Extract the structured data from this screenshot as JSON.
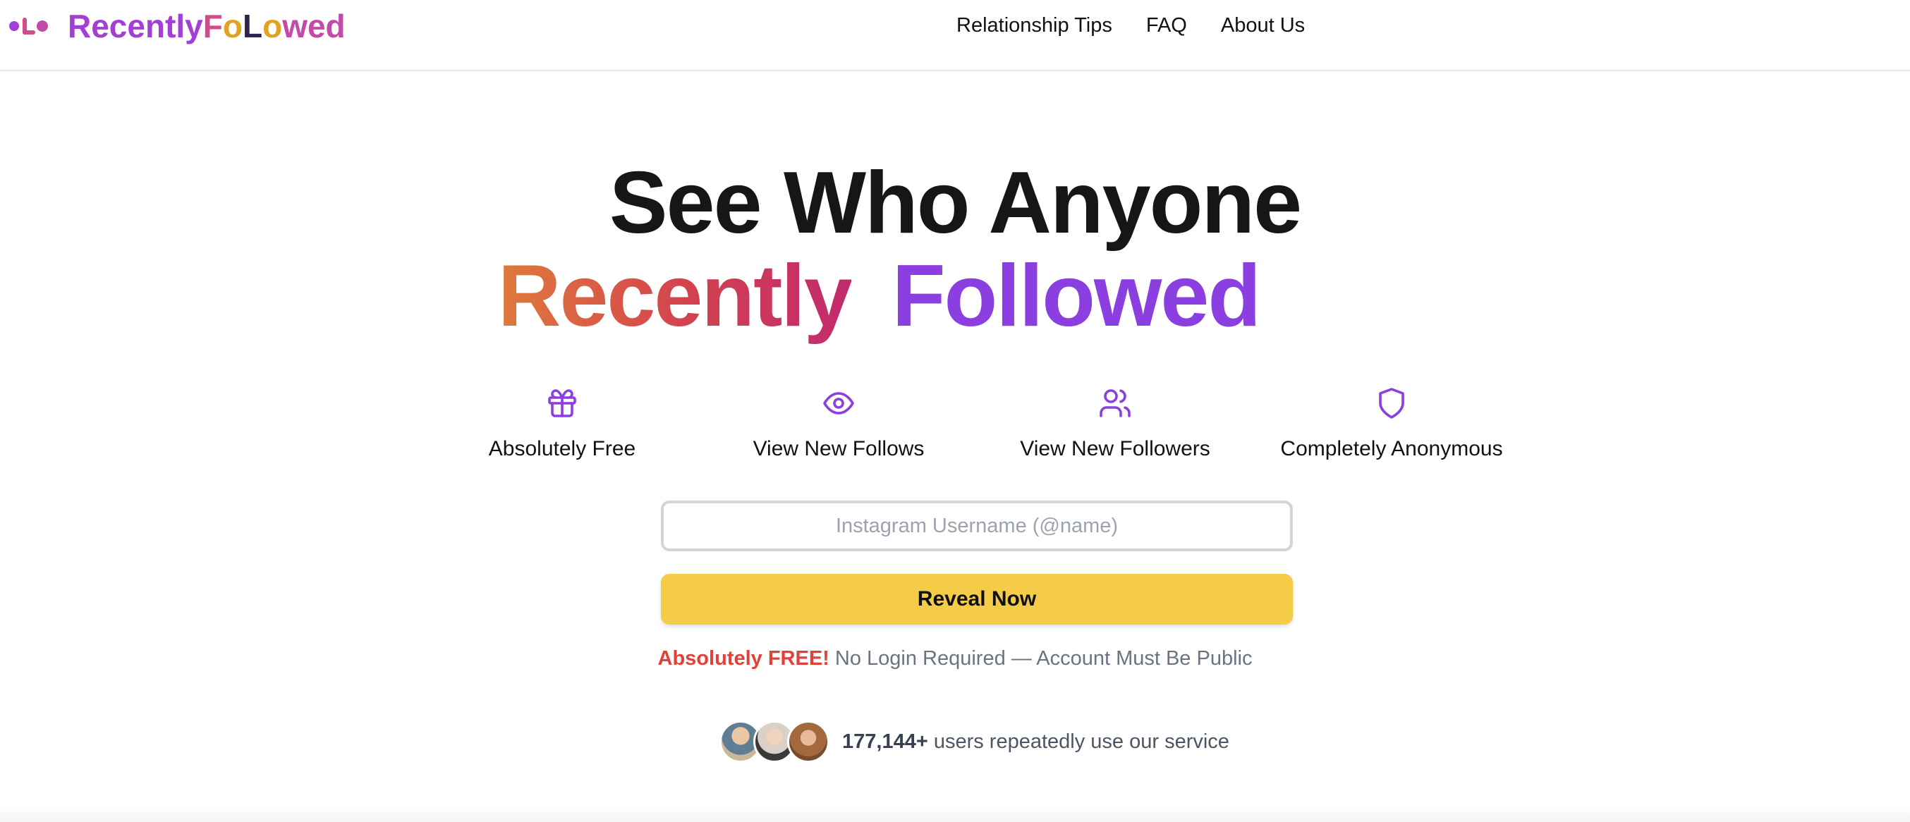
{
  "header": {
    "logo": {
      "icon": "logo-dots-icon",
      "letters": [
        {
          "text": "Recently",
          "color": "#a43fd6"
        },
        {
          "text": "F",
          "color": "#d24b8a"
        },
        {
          "text": "o",
          "color": "#e0a322"
        },
        {
          "text": "L",
          "color": "#2f2350"
        },
        {
          "text": "o",
          "color": "#e0a322"
        },
        {
          "text": "wed",
          "color": "#c34aa8"
        }
      ]
    },
    "nav": [
      "Relationship Tips",
      "FAQ",
      "About Us"
    ]
  },
  "hero": {
    "line1": "See Who Anyone",
    "line2_a": "Recently",
    "line2_b": "Followed"
  },
  "features": [
    {
      "icon": "gift-icon",
      "label": "Absolutely Free"
    },
    {
      "icon": "eye-icon",
      "label": "View New Follows"
    },
    {
      "icon": "users-icon",
      "label": "View New Followers"
    },
    {
      "icon": "shield-icon",
      "label": "Completely Anonymous"
    }
  ],
  "form": {
    "placeholder": "Instagram Username (@name)",
    "value": "",
    "button_label": "Reveal Now"
  },
  "note": {
    "strong": "Absolutely FREE!",
    "rest": " No Login Required — Account Must Be Public"
  },
  "social_proof": {
    "count": "177,144+",
    "text": " users repeatedly use our service",
    "avatars": [
      "avatar-1",
      "avatar-2",
      "avatar-3"
    ]
  },
  "colors": {
    "accent_purple": "#8b3fe0",
    "button_yellow": "#f4cc48",
    "free_red": "#e0423a"
  }
}
